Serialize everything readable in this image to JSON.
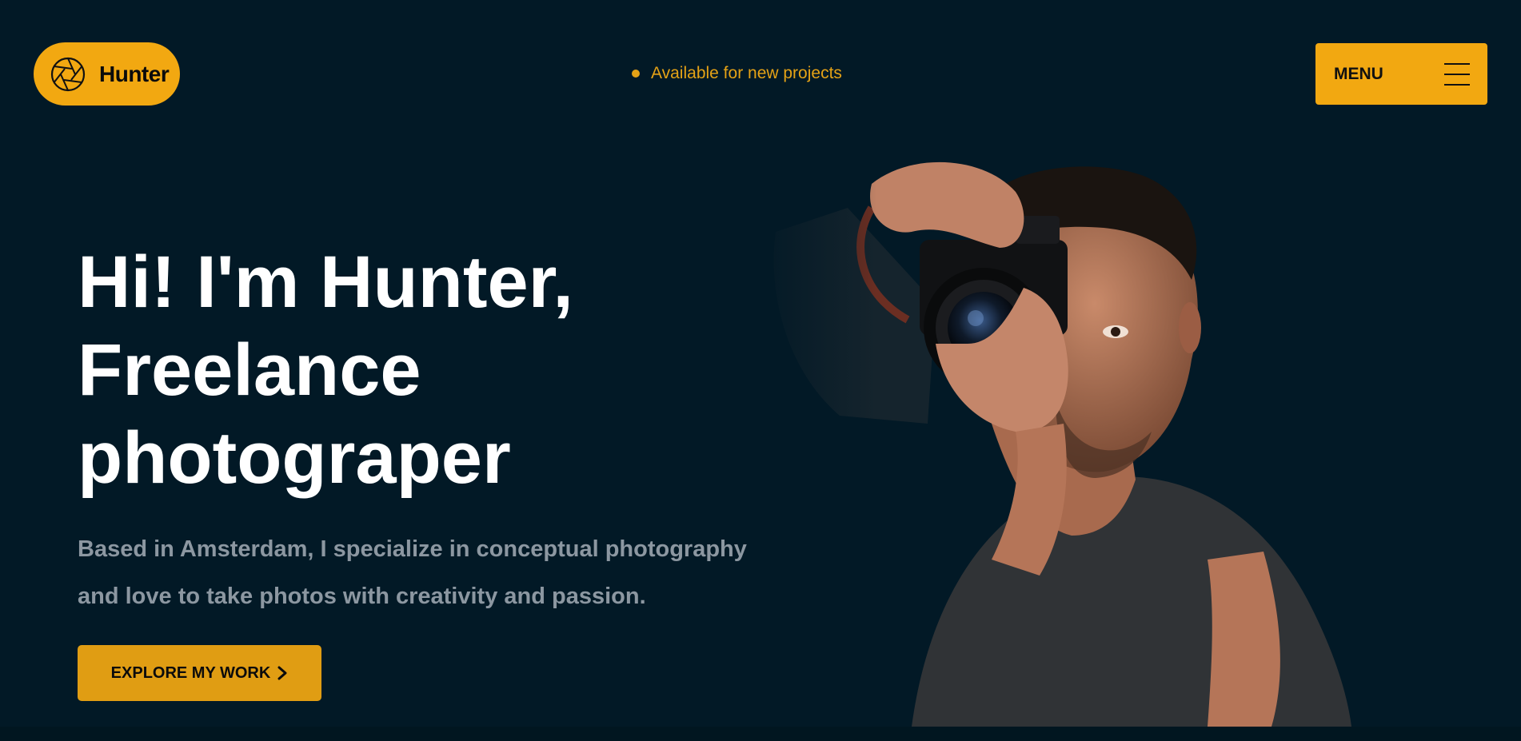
{
  "brand": {
    "name": "Hunter",
    "icon": "camera-aperture-icon",
    "color": "#F2A811"
  },
  "header": {
    "availability": "Available for new projects",
    "menu_label": "MENU",
    "menu_icon": "hamburger-icon"
  },
  "hero": {
    "title_lines": [
      "Hi! I'm Hunter,",
      "Freelance",
      "photograper"
    ],
    "subtitle_lines": [
      "Based in Amsterdam, I specialize in conceptual photography",
      "and love to take photos with creativity and passion."
    ],
    "cta_label": "EXPLORE MY WORK",
    "cta_icon": "chevron-right-icon",
    "image": "photographer-with-canon-camera"
  },
  "colors": {
    "background": "#021926",
    "accent": "#F2A811",
    "availability_text": "#E5A216",
    "subtitle_text": "#8C97A1",
    "title_text": "#FFFFFF"
  }
}
